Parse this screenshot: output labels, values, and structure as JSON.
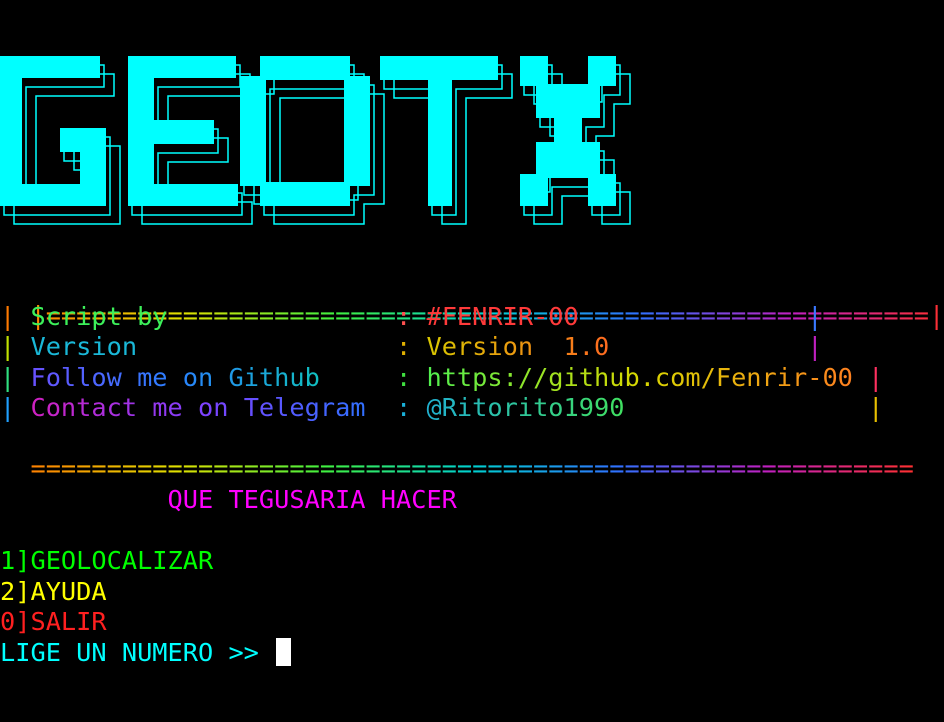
{
  "banner": {
    "text": "GEOTX",
    "color": "#00ffff"
  },
  "info_box": {
    "top_border": "|==========================================================|",
    "bottom_border": "==========================================================",
    "rows": [
      {
        "left_pipe": "| ",
        "label": "Script by",
        "label_pad": "               ",
        "sep": ": ",
        "value": "#FENRIR-00",
        "value_pad": "               ",
        "right_pipe": "|"
      },
      {
        "left_pipe": "| ",
        "label": "Version",
        "label_pad": "                 ",
        "sep": ": ",
        "value": "Version  1.0",
        "value_pad": "             ",
        "right_pipe": "|"
      },
      {
        "left_pipe": "| ",
        "label": "Follow me on Github",
        "label_pad": "     ",
        "sep": ": ",
        "value": "https://github.com/Fenrir-00",
        "value_pad": " ",
        "right_pipe": "|"
      },
      {
        "left_pipe": "| ",
        "label": "Contact me on Telegram",
        "label_pad": "  ",
        "sep": ": ",
        "value": "@Ritorito1990",
        "value_pad": "                ",
        "right_pipe": "|"
      }
    ]
  },
  "menu": {
    "title_indent": "           ",
    "title": "QUE TEGUSARIA HACER",
    "options": [
      {
        "key": "1]",
        "label": "GEOLOCALIZAR",
        "color": "#00ff00"
      },
      {
        "key": "2]",
        "label": "AYUDA",
        "color": "#ffff00"
      },
      {
        "key": "0]",
        "label": "SALIR",
        "color": "#ff2020"
      }
    ],
    "prompt": "LIGE UN NUMERO >> "
  },
  "colors": {
    "background": "#000000",
    "banner": "#00ffff",
    "menu_title": "#ff00ff",
    "prompt": "#00ffff",
    "cursor": "#ffffff"
  }
}
